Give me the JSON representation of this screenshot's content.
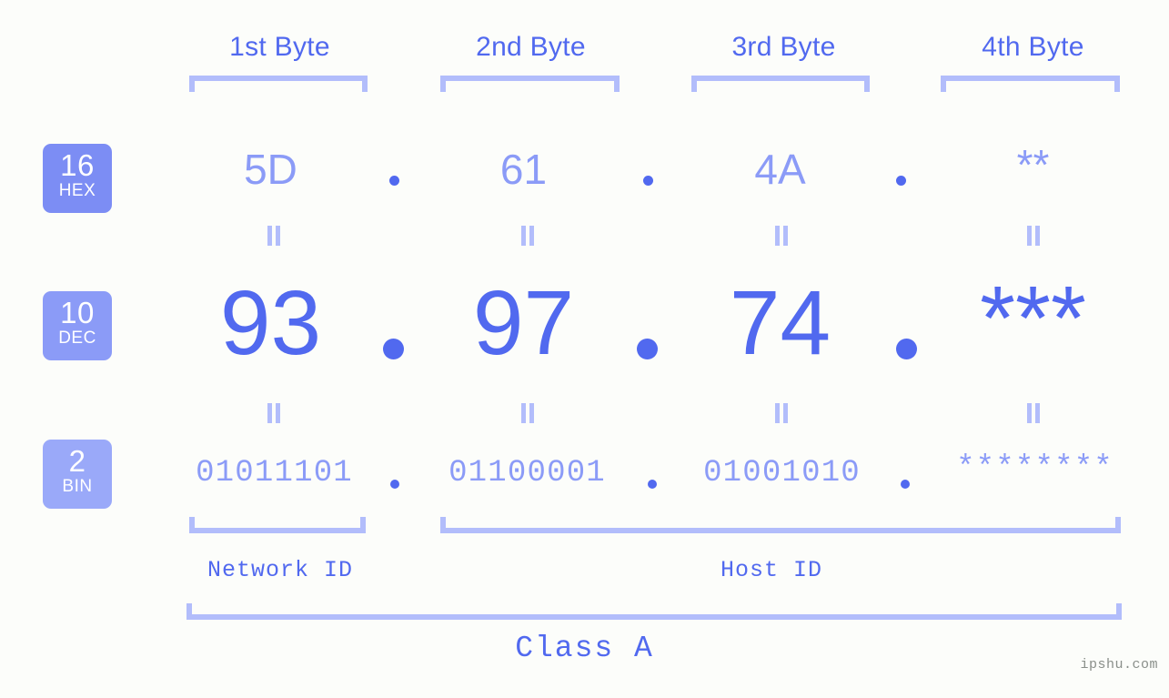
{
  "meta": {
    "background": "#fcfdfa",
    "accent_strong": "#5169ef",
    "accent_light": "#8b9bf7",
    "accent_pale": "#b2bdfb"
  },
  "byte_headers": [
    {
      "label": "1st Byte"
    },
    {
      "label": "2nd Byte"
    },
    {
      "label": "3rd Byte"
    },
    {
      "label": "4th Byte"
    }
  ],
  "bases": [
    {
      "number": "16",
      "name": "HEX",
      "color": "#7c8df4"
    },
    {
      "number": "10",
      "name": "DEC",
      "color": "#8b9bf7"
    },
    {
      "number": "2",
      "name": "BIN",
      "color": "#9aa9f9"
    }
  ],
  "rows": {
    "hex": {
      "values": [
        "5D",
        "61",
        "4A",
        "**"
      ],
      "separator": "."
    },
    "dec": {
      "values": [
        "93",
        "97",
        "74",
        "***"
      ],
      "separator": "."
    },
    "bin": {
      "values": [
        "01011101",
        "01100001",
        "01001010",
        "********"
      ],
      "separator": "."
    }
  },
  "equals_symbol": "=",
  "segments": {
    "network_id": "Network ID",
    "host_id": "Host ID",
    "class": "Class A"
  },
  "watermark": "ipshu.com"
}
